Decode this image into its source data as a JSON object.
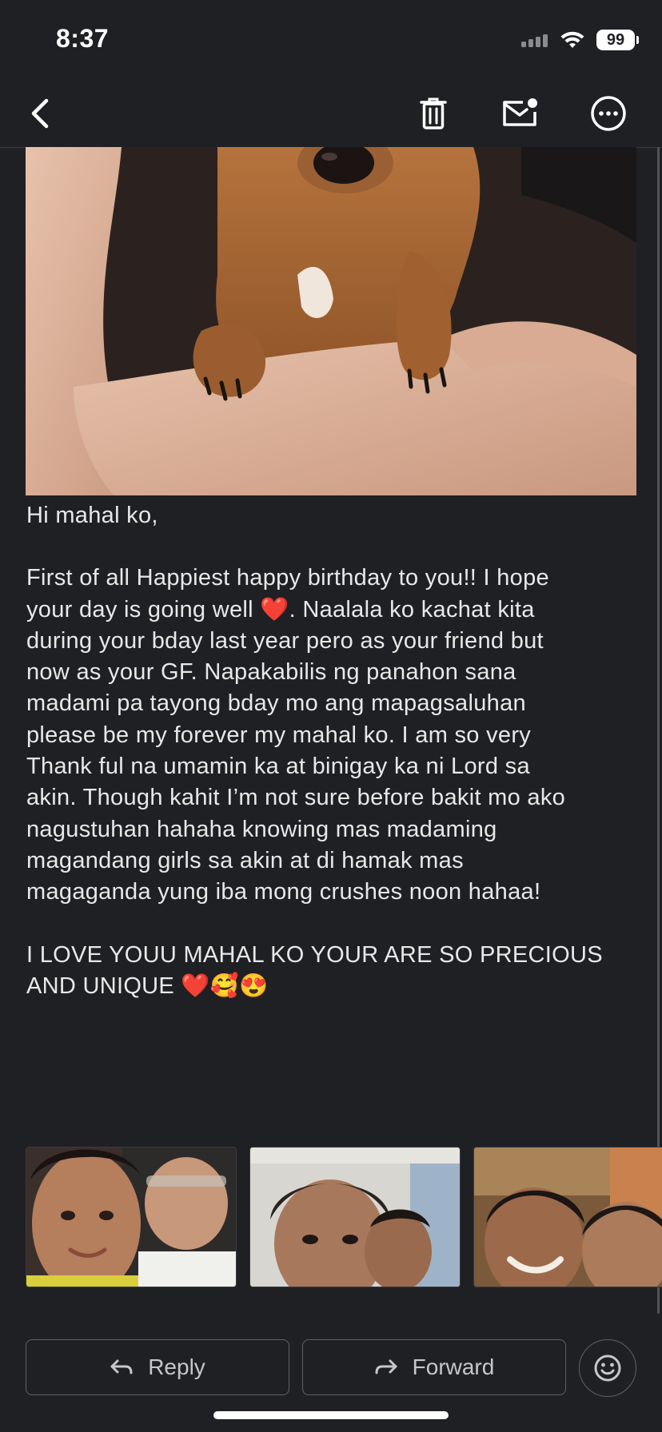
{
  "status_bar": {
    "time": "8:37",
    "battery": "99"
  },
  "toolbar": {
    "back_icon": "back-arrow-icon",
    "delete_icon": "trash-icon",
    "mark_unread_icon": "mail-unread-icon",
    "more_icon": "more-options-icon"
  },
  "message": {
    "greeting": "Hi mahal ko,",
    "paragraph1_lines": [
      "First of all Happiest happy birthday to you!! I hope",
      "your day is going well ❤️. Naalala ko kachat kita",
      "during your bday last year pero as your friend but",
      "now as your GF. Napakabilis ng panahon sana",
      "madami pa tayong bday mo ang mapagsaluhan",
      "please be my forever my mahal ko. I am so very",
      "Thank ful na umamin ka at binigay ka ni Lord sa",
      "akin. Though kahit I’m not sure before bakit mo ako",
      "nagustuhan hahaha knowing mas madaming",
      "magandang girls sa akin at di hamak mas",
      "magaganda yung iba mong crushes noon hahaa!"
    ],
    "paragraph2_lines": [
      "I LOVE YOUU MAHAL KO YOUR ARE SO PRECIOUS",
      "AND UNIQUE ❤️🥰😍"
    ]
  },
  "actions": {
    "reply_label": "Reply",
    "forward_label": "Forward",
    "emoji_icon": "smiley-icon"
  },
  "colors": {
    "background": "#1f2023",
    "text": "#e8e8e8",
    "button_border": "#5f6166"
  }
}
